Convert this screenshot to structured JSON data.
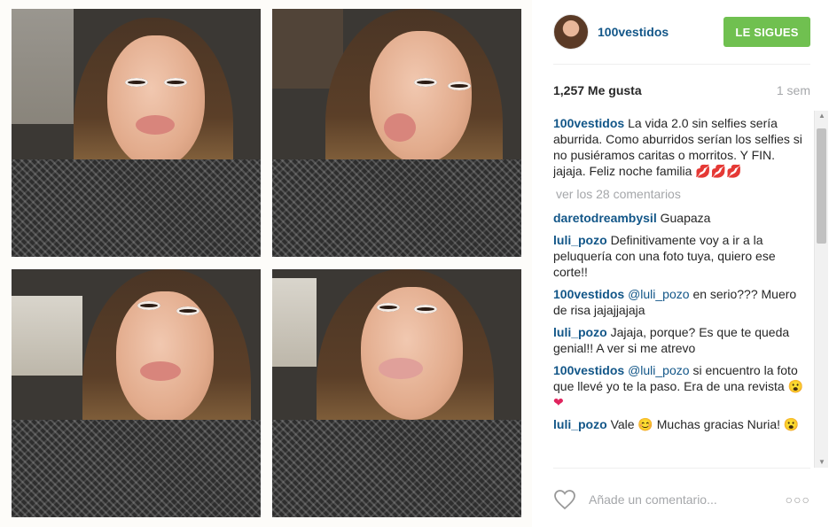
{
  "post": {
    "username": "100vestidos",
    "follow_label": "LE SIGUES",
    "likes": "1,257 Me gusta",
    "time": "1 sem",
    "caption_user": "100vestidos",
    "caption_text": "La vida 2.0 sin selfies sería aburrida. Como aburridos serían los selfies si no pusiéramos caritas o morritos. Y FIN. jajaja. Feliz noche familia",
    "caption_emoji": "💋💋💋",
    "view_more": "ver los 28 comentarios",
    "add_comment_placeholder": "Añade un comentario...",
    "options": "○○○"
  },
  "comments": [
    {
      "user": "daretodreambysil",
      "mention": "",
      "text": "Guapaza",
      "emoji": ""
    },
    {
      "user": "luli_pozo",
      "mention": "",
      "text": "Definitivamente voy a ir a la peluquería con una foto tuya, quiero ese corte!!",
      "emoji": ""
    },
    {
      "user": "100vestidos",
      "mention": "@luli_pozo",
      "text": "en serio??? Muero de risa jajajjajaja",
      "emoji": ""
    },
    {
      "user": "luli_pozo",
      "mention": "",
      "text": "Jajaja, porque? Es que te queda genial!! A ver si me atrevo",
      "emoji": ""
    },
    {
      "user": "100vestidos",
      "mention": "@luli_pozo",
      "text": "si encuentro la foto que llevé yo te la paso. Era de una revista",
      "emoji": "😮❤"
    },
    {
      "user": "luli_pozo",
      "mention": "",
      "text": "Vale 😊 Muchas gracias Nuria!",
      "emoji": "😮"
    }
  ],
  "colors": {
    "username_blue": "#125688",
    "follow_green": "#70c050",
    "muted_gray": "#a5a7aa"
  },
  "icons": {
    "heart": "heart-outline-icon",
    "scroll_up": "triangle-up-icon",
    "scroll_down": "triangle-down-icon"
  }
}
